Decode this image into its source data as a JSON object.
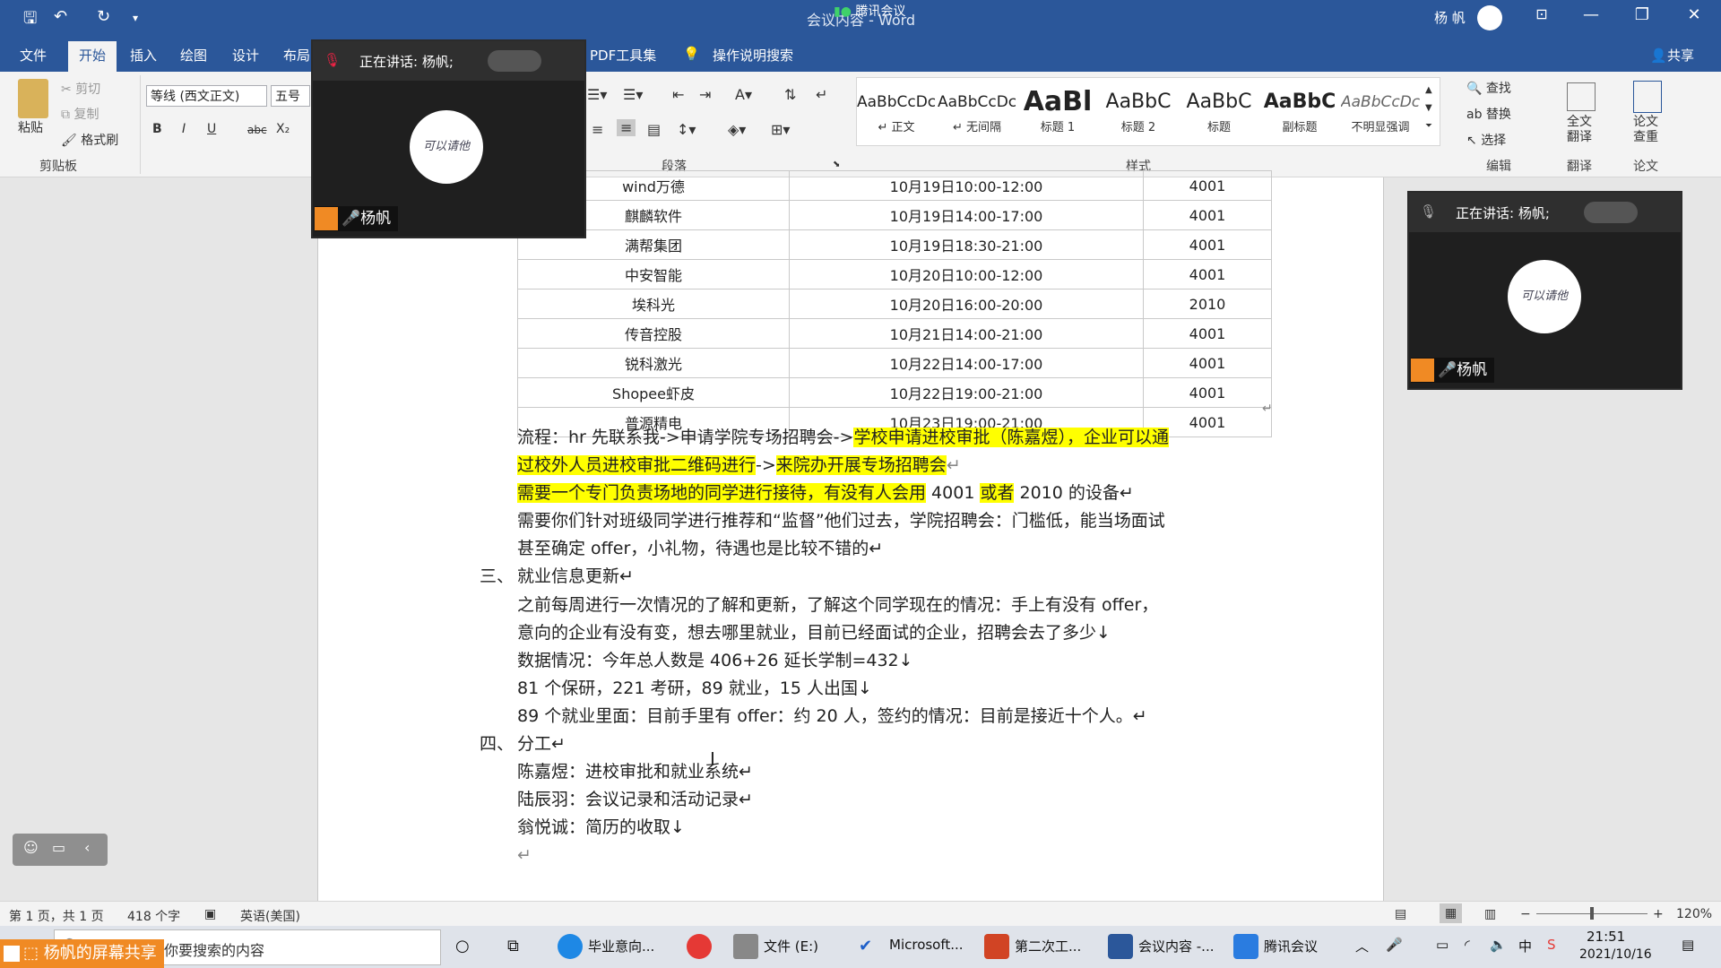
{
  "titlebar": {
    "doc_title": "会议内容 - Word",
    "meeting_badge": "腾讯会议",
    "user_name": "杨 帆",
    "minimize": "—",
    "restore": "❐",
    "close": "✕",
    "ribbon_display": "⊡"
  },
  "tabs": [
    "文件",
    "开始",
    "插入",
    "绘图",
    "设计",
    "布局",
    "PDF工具集",
    "操作说明搜索"
  ],
  "share_label": "共享",
  "clipboard": {
    "paste": "粘贴",
    "cut": "剪切",
    "copy": "复制",
    "format_painter": "格式刷",
    "group": "剪贴板"
  },
  "font": {
    "name": "等线 (西文正文)",
    "size": "五号",
    "bold": "B",
    "italic": "I",
    "underline": "U",
    "strike": "abc",
    "sub": "X₂"
  },
  "paragraph": {
    "group": "段落"
  },
  "styles": {
    "group": "样式",
    "items": [
      {
        "preview": "AaBbCcDc",
        "name": "↵ 正文"
      },
      {
        "preview": "AaBbCcDc",
        "name": "↵ 无间隔"
      },
      {
        "preview": "AaBl",
        "name": "标题 1"
      },
      {
        "preview": "AaBbC",
        "name": "标题 2"
      },
      {
        "preview": "AaBbC",
        "name": "标题"
      },
      {
        "preview": "AaBbC",
        "name": "副标题"
      },
      {
        "preview": "AaBbCcDc",
        "name": "不明显强调"
      }
    ]
  },
  "editing": {
    "find": "查找",
    "replace": "替换",
    "select": "选择",
    "group": "编辑"
  },
  "translate": {
    "full": "全文\n翻译",
    "group": "翻译"
  },
  "paper": {
    "check": "论文\n查重",
    "group": "论文"
  },
  "table_rows": [
    [
      "wind万德",
      "10月19日10:00-12:00",
      "4001"
    ],
    [
      "麒麟软件",
      "10月19日14:00-17:00",
      "4001"
    ],
    [
      "满帮集团",
      "10月19日18:30-21:00",
      "4001"
    ],
    [
      "中安智能",
      "10月20日10:00-12:00",
      "4001"
    ],
    [
      "埃科光",
      "10月20日16:00-20:00",
      "2010"
    ],
    [
      "传音控股",
      "10月21日14:00-21:00",
      "4001"
    ],
    [
      "锐科激光",
      "10月22日14:00-17:00",
      "4001"
    ],
    [
      "Shopee虾皮",
      "10月22日19:00-21:00",
      "4001"
    ],
    [
      "普源精电",
      "10月23日19:00-21:00",
      "4001"
    ]
  ],
  "body": {
    "p1a": "流程：hr 先联系我->申请学院专场招聘会->",
    "p1b": "学校申请进校审批（陈嘉煜），企业可以通",
    "p2a": "过校外人员进校审批二维码进行",
    "p2b": "->",
    "p2c": "来院办开展专场招聘会",
    "p3a": "需要一个专门负责场地的同学进行接待，有没有人会用",
    "p3b": " 4001 ",
    "p3c": "或者",
    "p3d": " 2010 的设备↵",
    "p4": "需要你们针对班级同学进行推荐和“监督”他们过去，学院招聘会：门槛低，能当场面试",
    "p5": "甚至确定 offer，小礼物，待遇也是比较不错的↵",
    "h3_num": "三、",
    "h3": "就业信息更新↵",
    "p6": "之前每周进行一次情况的了解和更新，了解这个同学现在的情况：手上有没有  offer，",
    "p7": "意向的企业有没有变，想去哪里就业，目前已经面试的企业，招聘会去了多少↓",
    "p8": "数据情况：今年总人数是 406+26 延长学制=432↓",
    "p9": "81 个保研，221 考研，89 就业，15 人出国↓",
    "p10": "89 个就业里面：目前手里有 offer：约 20 人，签约的情况：目前是接近十个人。↵",
    "h4_num": "四、",
    "h4": "分工↵",
    "p11": "陈嘉煜：进校审批和就业系统↵",
    "p12": "陆辰羽：会议记录和活动记录↵",
    "p13": "翁悦诚：简历的收取↓",
    "p14": "↵"
  },
  "meeting": {
    "speaking": "正在讲话: 杨帆;",
    "name": "杨帆",
    "avatar_text": "可以请他"
  },
  "statusbar": {
    "page": "第 1 页，共 1 页",
    "words": "418 个字",
    "lang": "英语(美国)",
    "zoom": "120%"
  },
  "taskbar": {
    "search": "在这里输入你要搜索的内容",
    "items": [
      "毕业意向...",
      "文件 (E:)",
      "Microsoft...",
      "第二次工...",
      "会议内容 -...",
      "腾讯会议"
    ],
    "time": "21:51",
    "date": "2021/10/16",
    "ime": "中",
    "share_label": "杨帆的屏幕共享"
  }
}
